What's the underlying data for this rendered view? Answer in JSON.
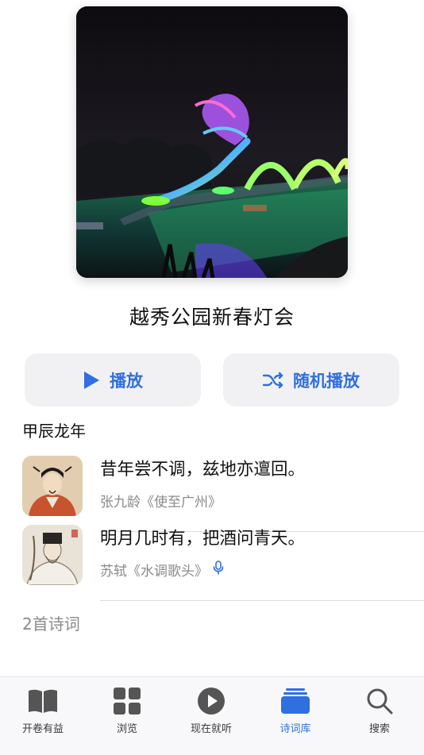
{
  "album": {
    "title": "越秀公园新春灯会",
    "cover_icon": "dragon-lantern-night-photo"
  },
  "actions": {
    "play_label": "播放",
    "shuffle_label": "随机播放",
    "accent_color": "#2f6fe0"
  },
  "section": {
    "label": "甲辰龙年"
  },
  "poems": [
    {
      "line": "昔年尝不调，兹地亦邅回。",
      "source": "张九龄《使至广州》",
      "has_audio": false,
      "avatar": "portrait-zhang-jiuling"
    },
    {
      "line": "明月几时有，把酒问青天。",
      "source": "苏轼《水调歌头》",
      "has_audio": true,
      "avatar": "portrait-su-shi"
    }
  ],
  "count_text": "2首诗词",
  "tabs": [
    {
      "label": "开卷有益",
      "icon": "open-book-icon",
      "active": false
    },
    {
      "label": "浏览",
      "icon": "grid-icon",
      "active": false
    },
    {
      "label": "现在就听",
      "icon": "play-circle-icon",
      "active": false
    },
    {
      "label": "诗词库",
      "icon": "library-stack-icon",
      "active": true
    },
    {
      "label": "搜索",
      "icon": "search-icon",
      "active": false
    }
  ]
}
